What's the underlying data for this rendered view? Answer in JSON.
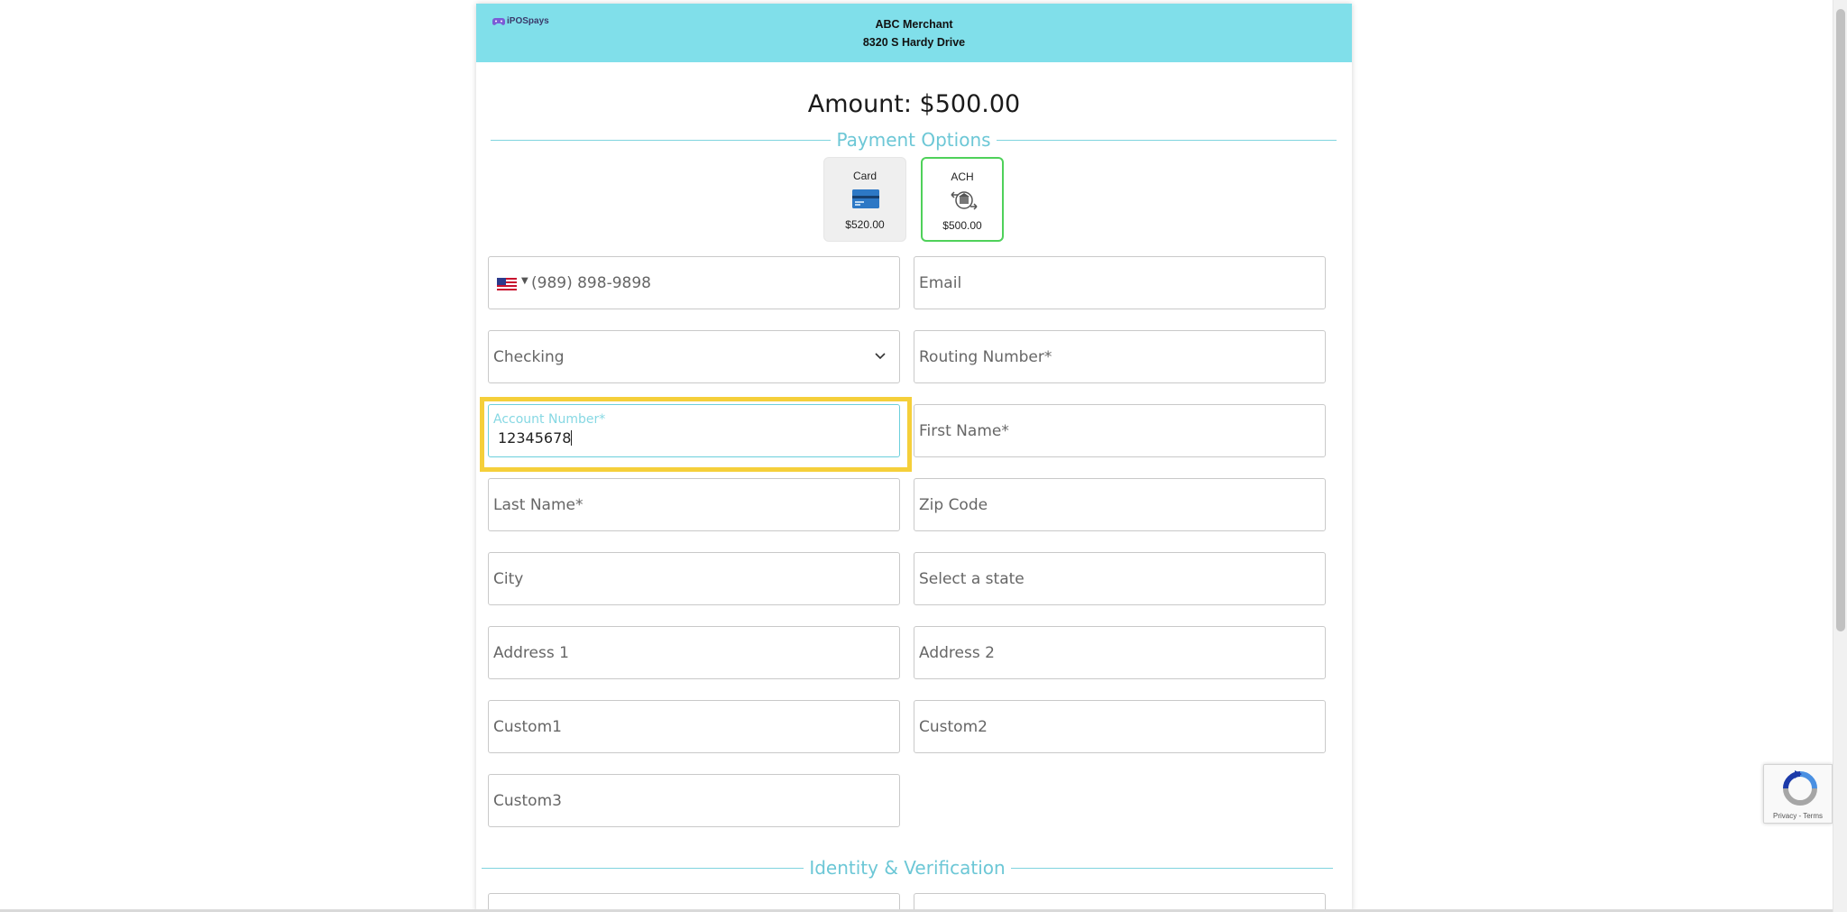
{
  "header": {
    "logo_text": "iPOSpays",
    "merchant_name": "ABC Merchant",
    "merchant_address": "8320 S Hardy Drive"
  },
  "amount_text": "Amount: $500.00",
  "payment_section_title": "Payment Options",
  "payment_options": [
    {
      "label": "Card",
      "price": "$520.00",
      "icon": "credit-card-icon",
      "selected": false
    },
    {
      "label": "ACH",
      "price": "$500.00",
      "icon": "bank-transfer-icon",
      "selected": true
    }
  ],
  "form": {
    "phone": {
      "placeholder": "(989) 898-9898",
      "country": "US"
    },
    "email": {
      "placeholder": "Email"
    },
    "account_type": {
      "selected": "Checking"
    },
    "routing_number": {
      "placeholder": "Routing Number*"
    },
    "account_number": {
      "label": "Account Number*",
      "value": "12345678"
    },
    "first_name": {
      "placeholder": "First Name*"
    },
    "last_name": {
      "placeholder": "Last Name*"
    },
    "zip_code": {
      "placeholder": "Zip Code"
    },
    "city": {
      "placeholder": "City"
    },
    "state": {
      "placeholder": "Select a state"
    },
    "address1": {
      "placeholder": "Address 1"
    },
    "address2": {
      "placeholder": "Address 2"
    },
    "custom1": {
      "placeholder": "Custom1"
    },
    "custom2": {
      "placeholder": "Custom2"
    },
    "custom3": {
      "placeholder": "Custom3"
    }
  },
  "identity_section_title": "Identity & Verification",
  "recaptcha": {
    "links": "Privacy - Terms"
  },
  "colors": {
    "header_bg": "#80dfea",
    "accent": "#6cc7d6",
    "selected_border": "#4fd15a",
    "highlight": "#f5cf3a"
  }
}
